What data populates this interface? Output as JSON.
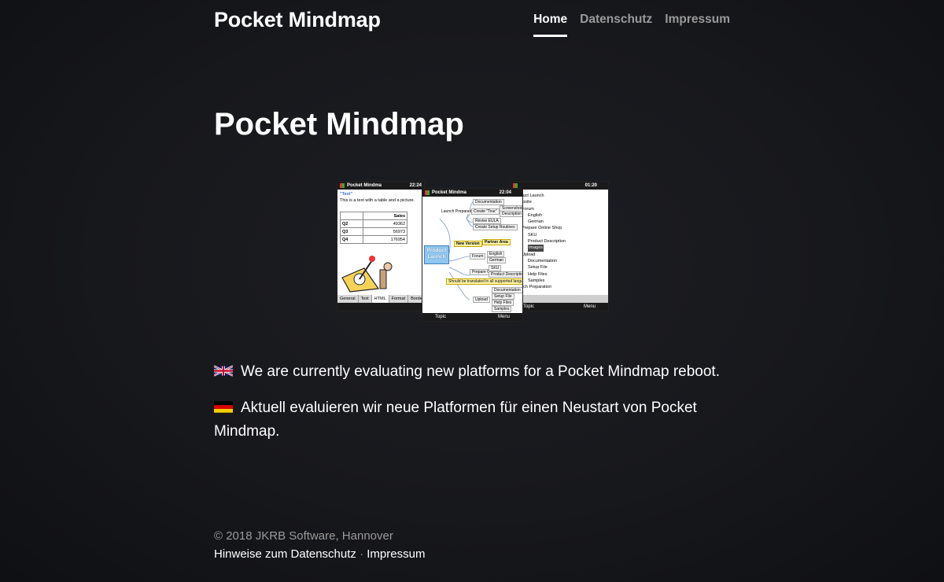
{
  "header": {
    "brand": "Pocket Mindmap",
    "nav": [
      {
        "label": "Home",
        "active": true
      },
      {
        "label": "Datenschutz",
        "active": false
      },
      {
        "label": "Impressum",
        "active": false
      }
    ]
  },
  "main": {
    "heading": "Pocket Mindmap",
    "screenshot": {
      "left": {
        "title": "Pocket Mindma",
        "time": "22:24",
        "link": "\"Text\"",
        "caption": "This is a text with a table and a picture.",
        "table_header": "Sales",
        "rows": [
          [
            "Q2",
            "49362"
          ],
          [
            "Q3",
            "56973"
          ],
          [
            "Q4",
            "176954"
          ]
        ],
        "tabs": [
          "General",
          "Text",
          "HTML",
          "Format",
          "Border"
        ]
      },
      "center": {
        "title": "Pocket Mindma",
        "time": "22:04",
        "central": "Product Launch",
        "nodes": [
          "Launch Preparation",
          "Documentation",
          "Create \"Tour\"",
          "Screenshots",
          "Description",
          "Revise EULA",
          "Create Setup Routines",
          "New Version",
          "Partner Area",
          "Forum",
          "English",
          "German",
          "Prepare Online",
          "SKU",
          "Product Description",
          "Should be translated in all supported languages",
          "Documentation",
          "Upload",
          "Setup File",
          "Help Files",
          "Samples"
        ],
        "softkeys": [
          "Topic",
          "Menu"
        ]
      },
      "right": {
        "time": "01:20",
        "tree": [
          "Product Launch",
          "Website",
          "Forum",
          "English",
          "German",
          "Prepare Online Shop",
          "SKU",
          "Product Description",
          "Images",
          "Upload",
          "Documentation",
          "Setup File",
          "Help Files",
          "Samples",
          "Launch Preparation"
        ],
        "softkeys": [
          "Topic",
          "Menu"
        ]
      }
    },
    "messages": {
      "en": "We are currently evaluating new platforms for a Pocket Mindmap reboot.",
      "de": "Aktuell evaluieren wir neue Platformen für einen Neustart von Pocket Mindmap."
    }
  },
  "footer": {
    "copyright": "© 2018 JKRB Software, Hannover",
    "privacy_link": "Hinweise zum Datenschutz",
    "separator": "·",
    "imprint_link": "Impressum"
  }
}
